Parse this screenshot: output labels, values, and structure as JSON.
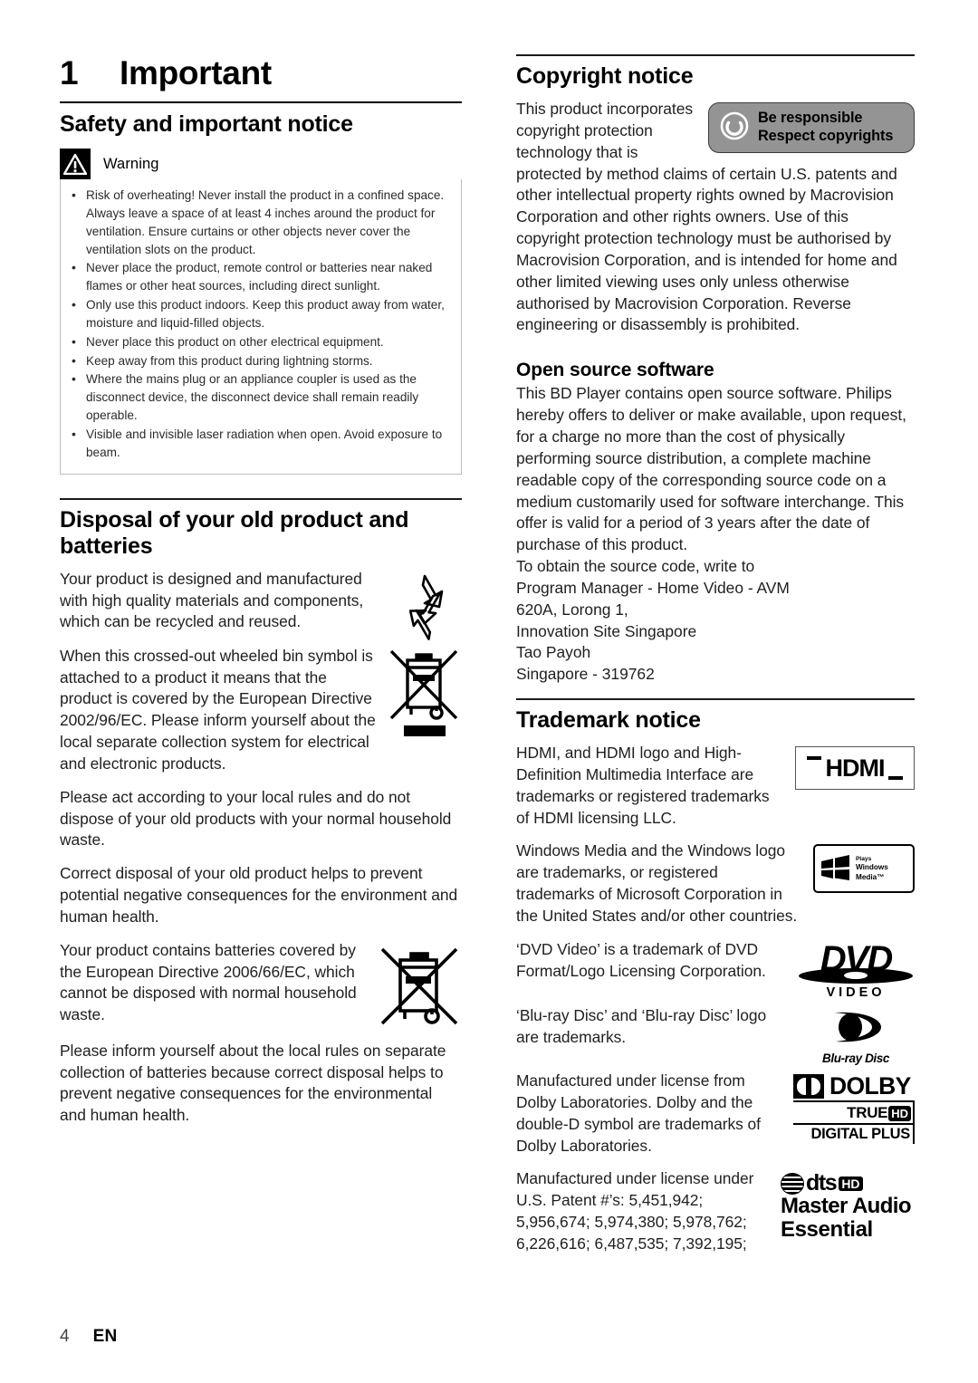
{
  "footer": {
    "page_number": "4",
    "language": "EN"
  },
  "chapter": {
    "number": "1",
    "title": "Important"
  },
  "left": {
    "section_title": "Safety and important notice",
    "warning": {
      "label": "Warning",
      "icon": "warning-triangle-icon",
      "items": [
        "Risk of overheating! Never install the product in a confined space. Always leave a space of at least 4 inches around the product for ventilation. Ensure curtains or other objects never cover the ventilation slots on the product.",
        "Never place the product, remote control or batteries near naked flames or other heat sources, including direct sunlight.",
        "Only use this product indoors. Keep this product away from water, moisture and liquid-filled objects.",
        "Never place this product on other electrical equipment.",
        "Keep away from this product during lightning storms.",
        "Where the mains plug or an appliance coupler is used as the disconnect device, the disconnect device shall remain readily operable.",
        "Visible and invisible laser radiation when open. Avoid exposure to beam."
      ]
    },
    "disposal": {
      "heading": "Disposal of your old product and batteries",
      "p1": "Your product is designed and manufactured with high quality materials and components, which can be recycled and reused.",
      "p2": "When this crossed-out wheeled bin symbol is attached to a product it means that the product is covered by the European Directive 2002/96/EC. Please inform yourself about the local separate collection system for electrical and electronic products.",
      "p3": "Please act according to your local rules and do not dispose of your old products with your normal household waste.",
      "p4": "Correct disposal of your old product helps to prevent potential negative consequences for the environment and human health.",
      "p5": "Your product contains batteries covered by the European Directive 2006/66/EC, which cannot be disposed with normal household waste.",
      "p6": "Please inform yourself about the local rules on separate collection of batteries because correct disposal helps to prevent negative consequences for the environmental and human health.",
      "icons": [
        "recycle-mobius-icon",
        "crossed-out-wheeled-bin-icon",
        "black-bar-icon",
        "crossed-out-wheeled-bin-battery-icon"
      ]
    }
  },
  "right": {
    "copyright": {
      "heading": "Copyright notice",
      "badge": {
        "line1": "Be responsible",
        "line2": "Respect copyrights",
        "icon": "copyright-power-circle-icon",
        "bg_color": "#949494"
      },
      "body": "This product incorporates copyright protection technology that is protected by method claims of certain U.S. patents and other intellectual property rights owned by Macrovision Corporation and other rights owners. Use of this copyright protection technology must be authorised by Macrovision Corporation, and is intended for home and other limited viewing uses only unless otherwise authorised by Macrovision Corporation. Reverse engineering or disassembly is prohibited."
    },
    "open_source": {
      "heading": "Open source software",
      "body": "This BD Player contains open source software. Philips hereby offers to deliver or make available, upon request, for a charge no more than the cost of physically performing source distribution, a complete machine readable copy of the corresponding source code on a medium customarily used for software interchange. This offer is valid for a period of 3 years after the date of purchase of this product.",
      "address_intro": "To obtain the source code, write to",
      "address": [
        "Program Manager - Home Video - AVM",
        "620A, Lorong 1,",
        "Innovation Site Singapore",
        "Tao Payoh",
        "Singapore - 319762"
      ]
    },
    "trademark": {
      "heading": "Trademark notice",
      "hdmi": {
        "text": "HDMI, and HDMI logo and High-Definition Multimedia Interface are trademarks or registered trademarks of HDMI licensing LLC.",
        "logo_label": "HDMI",
        "icon": "hdmi-logo-icon"
      },
      "windows": {
        "text": "Windows Media and the Windows logo are trademarks, or registered trademarks of Microsoft Corporation in the United States and/or other countries.",
        "logo_line1": "Plays",
        "logo_line2": "Windows",
        "logo_line3": "Media™",
        "icon": "plays-windows-media-logo-icon"
      },
      "dvd": {
        "text": "‘DVD Video’ is a trademark of DVD Format/Logo Licensing Corporation.",
        "logo_top": "DVD",
        "logo_bottom": "VIDEO",
        "icon": "dvd-video-logo-icon"
      },
      "bluray": {
        "text": "‘Blu-ray Disc’ and ‘Blu-ray Disc’ logo are trademarks.",
        "logo_word": "Blu-ray Disc",
        "icon": "blu-ray-disc-logo-icon"
      },
      "dolby": {
        "text": "Manufactured under license from Dolby Laboratories. Dolby and the double-D symbol are trademarks of Dolby Laboratories.",
        "logo_word": "DOLBY",
        "logo_true": "TRUE",
        "logo_hd": "HD",
        "logo_dp": "DIGITAL PLUS",
        "icon": "dolby-truehd-digital-plus-logo-icon"
      },
      "dts": {
        "text": "Manufactured under license under U.S. Patent #’s: 5,451,942; 5,956,674; 5,974,380; 5,978,762; 6,226,616; 6,487,535; 7,392,195;",
        "logo_word": "dts",
        "logo_hd": "HD",
        "logo_line2": "Master Audio",
        "logo_line3": "Essential",
        "icon": "dts-hd-master-audio-logo-icon"
      }
    }
  }
}
